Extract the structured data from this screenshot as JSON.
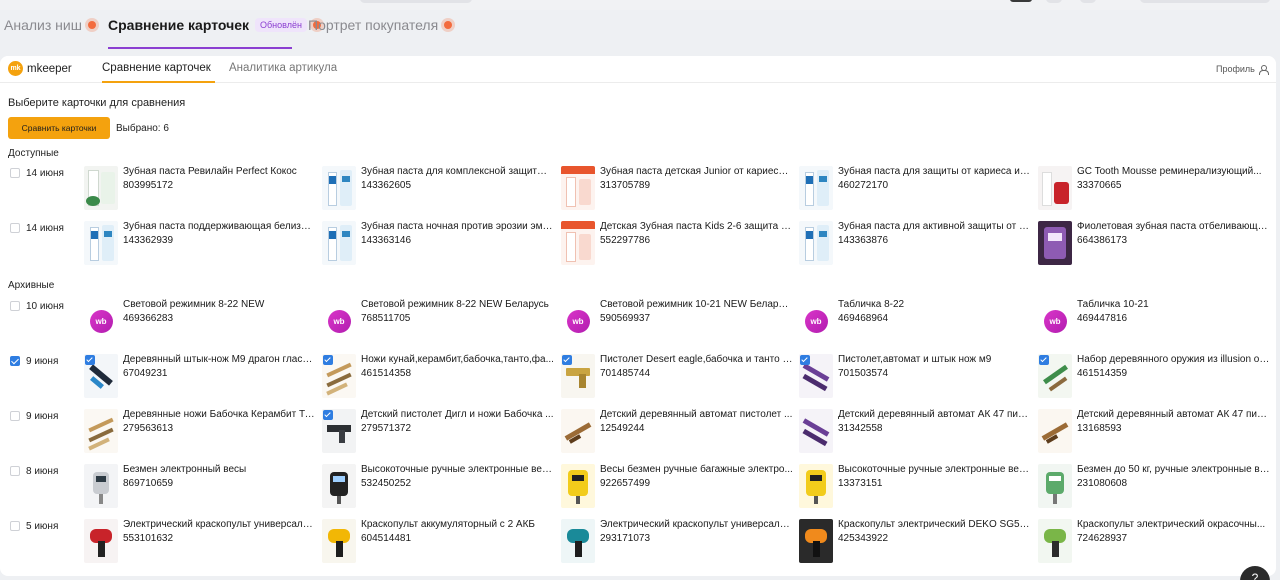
{
  "marketplace_tabs": [
    {
      "label": "Анализ ниш",
      "badge": ""
    },
    {
      "label": "Сравнение карточек",
      "badge": "Обновлён"
    },
    {
      "label": "Портрет покупателя",
      "badge": ""
    }
  ],
  "app": {
    "logo_mark": "mk",
    "logo_text": "mkeeper",
    "tabs": [
      "Сравнение карточек",
      "Аналитика артикула"
    ],
    "profile_label": "Профиль"
  },
  "section": {
    "title": "Выберите карточки для сравнения",
    "compare_button": "Сравнить карточки",
    "selected_text": "Выбрано: 6"
  },
  "groups": {
    "available_label": "Доступные",
    "archive_label": "Архивные"
  },
  "rows": [
    {
      "date": "14 июня",
      "checked": false,
      "cards": [
        {
          "name": "Зубная паста Ревилайн Perfect Кокос",
          "article": "803995172",
          "thumb": "toothpaste-green",
          "checked": false
        },
        {
          "name": "Зубная паста для комплексной защиты Т...",
          "article": "143362605",
          "thumb": "toothpaste-blue",
          "checked": false
        },
        {
          "name": "Зубная паста детская Junior от кариеса ...",
          "article": "313705789",
          "thumb": "toothpaste-kids-red",
          "checked": false
        },
        {
          "name": "Зубная паста для защиты от кариеса и у...",
          "article": "460272170",
          "thumb": "toothpaste-blue",
          "checked": false
        },
        {
          "name": "GC Tooth Mousse реминерализующий...",
          "article": "33370665",
          "thumb": "tooth-mousse-red",
          "checked": false
        }
      ]
    },
    {
      "date": "14 июня",
      "checked": false,
      "cards": [
        {
          "name": "Зубная паста поддерживающая белизну...",
          "article": "143362939",
          "thumb": "toothpaste-blue",
          "checked": false
        },
        {
          "name": "Зубная паста ночная против эрозии эма...",
          "article": "143363146",
          "thumb": "toothpaste-blue",
          "checked": false
        },
        {
          "name": "Детская Зубная паста Kids 2-6 защита о...",
          "article": "552297786",
          "thumb": "toothpaste-kids-red",
          "checked": false
        },
        {
          "name": "Зубная паста для активной защиты от ка...",
          "article": "143363876",
          "thumb": "toothpaste-blue",
          "checked": false
        },
        {
          "name": "Фиолетовая зубная паста отбеливающа...",
          "article": "664386173",
          "thumb": "toothpaste-purple",
          "checked": false
        }
      ]
    },
    {
      "date": "10 июня",
      "checked": false,
      "cards": [
        {
          "name": "Световой режимник 8-22 NEW",
          "article": "469366283",
          "thumb": "wb-logo",
          "checked": false
        },
        {
          "name": "Световой режимник 8-22 NEW Беларусь",
          "article": "768511705",
          "thumb": "wb-logo",
          "checked": false
        },
        {
          "name": "Световой режимник 10-21 NEW Беларусь",
          "article": "590569937",
          "thumb": "wb-logo",
          "checked": false
        },
        {
          "name": "Табличка 8-22",
          "article": "469468964",
          "thumb": "wb-logo",
          "checked": false
        },
        {
          "name": "Табличка 10-21",
          "article": "469447816",
          "thumb": "wb-logo",
          "checked": false
        }
      ]
    },
    {
      "date": "9 июня",
      "checked": true,
      "cards": [
        {
          "name": "Деревянный штык-нож М9 драгон гласс ...",
          "article": "67049231",
          "thumb": "knife-dark",
          "checked": true
        },
        {
          "name": "Ножи кунай,керамбит,бабочка,танто,фа...",
          "article": "461514358",
          "thumb": "knives-wood",
          "checked": true
        },
        {
          "name": "Пистолет Desert eagle,бабочка и танто ill...",
          "article": "701485744",
          "thumb": "pistol-gold",
          "checked": true
        },
        {
          "name": "Пистолет,автомат и штык нож м9",
          "article": "701503574",
          "thumb": "guns-purple",
          "checked": true
        },
        {
          "name": "Набор деревянного оружия из illusion of ...",
          "article": "461514359",
          "thumb": "weapons-green",
          "checked": true
        }
      ]
    },
    {
      "date": "9 июня",
      "checked": false,
      "cards": [
        {
          "name": "Деревянные ножи Бабочка Керамбит Та...",
          "article": "279563613",
          "thumb": "knives-wood",
          "checked": false
        },
        {
          "name": "Детский пистолет Дигл и ножи Бабочка ...",
          "article": "279571372",
          "thumb": "guns-dark",
          "checked": true
        },
        {
          "name": "Детский деревянный автомат пистолет ...",
          "article": "12549244",
          "thumb": "rifle-wood",
          "checked": false
        },
        {
          "name": "Детский деревянный автомат АК 47 пис...",
          "article": "31342558",
          "thumb": "guns-purple",
          "checked": false
        },
        {
          "name": "Детский деревянный автомат АК 47 пис...",
          "article": "13168593",
          "thumb": "rifle-wood",
          "checked": false
        }
      ]
    },
    {
      "date": "8 июня",
      "checked": false,
      "cards": [
        {
          "name": "Безмен электронный весы",
          "article": "869710659",
          "thumb": "scale-gray",
          "checked": false
        },
        {
          "name": "Высокоточные ручные электронные вес...",
          "article": "532450252",
          "thumb": "scale-dark",
          "checked": false
        },
        {
          "name": "Весы безмен ручные багажные электро...",
          "article": "922657499",
          "thumb": "scale-yellow",
          "checked": false
        },
        {
          "name": "Высокоточные ручные электронные вес...",
          "article": "13373151",
          "thumb": "scale-yellow",
          "checked": false
        },
        {
          "name": "Безмен до 50 кг, ручные электронные ве...",
          "article": "231080608",
          "thumb": "scale-green",
          "checked": false
        }
      ]
    },
    {
      "date": "5 июня",
      "checked": false,
      "cards": [
        {
          "name": "Электрический краскопульт универсаль...",
          "article": "553101632",
          "thumb": "spray-red",
          "checked": false
        },
        {
          "name": "Краскопульт аккумуляторный с 2 АКБ",
          "article": "604514481",
          "thumb": "spray-yellow",
          "checked": false
        },
        {
          "name": "Электрический краскопульт универсаль...",
          "article": "293171073",
          "thumb": "spray-teal",
          "checked": false
        },
        {
          "name": "Краскопульт электрический DEKO SG50...",
          "article": "425343922",
          "thumb": "spray-orange",
          "checked": false
        },
        {
          "name": "Краскопульт электрический окрасочны...",
          "article": "724628937",
          "thumb": "spray-green",
          "checked": false
        }
      ]
    }
  ],
  "help_label": "?",
  "colors": {
    "accent": "#f4a20e",
    "brand_purple": "#8b3fd1",
    "checkbox_blue": "#2f7de1",
    "update_dot": "#f36b3d"
  }
}
